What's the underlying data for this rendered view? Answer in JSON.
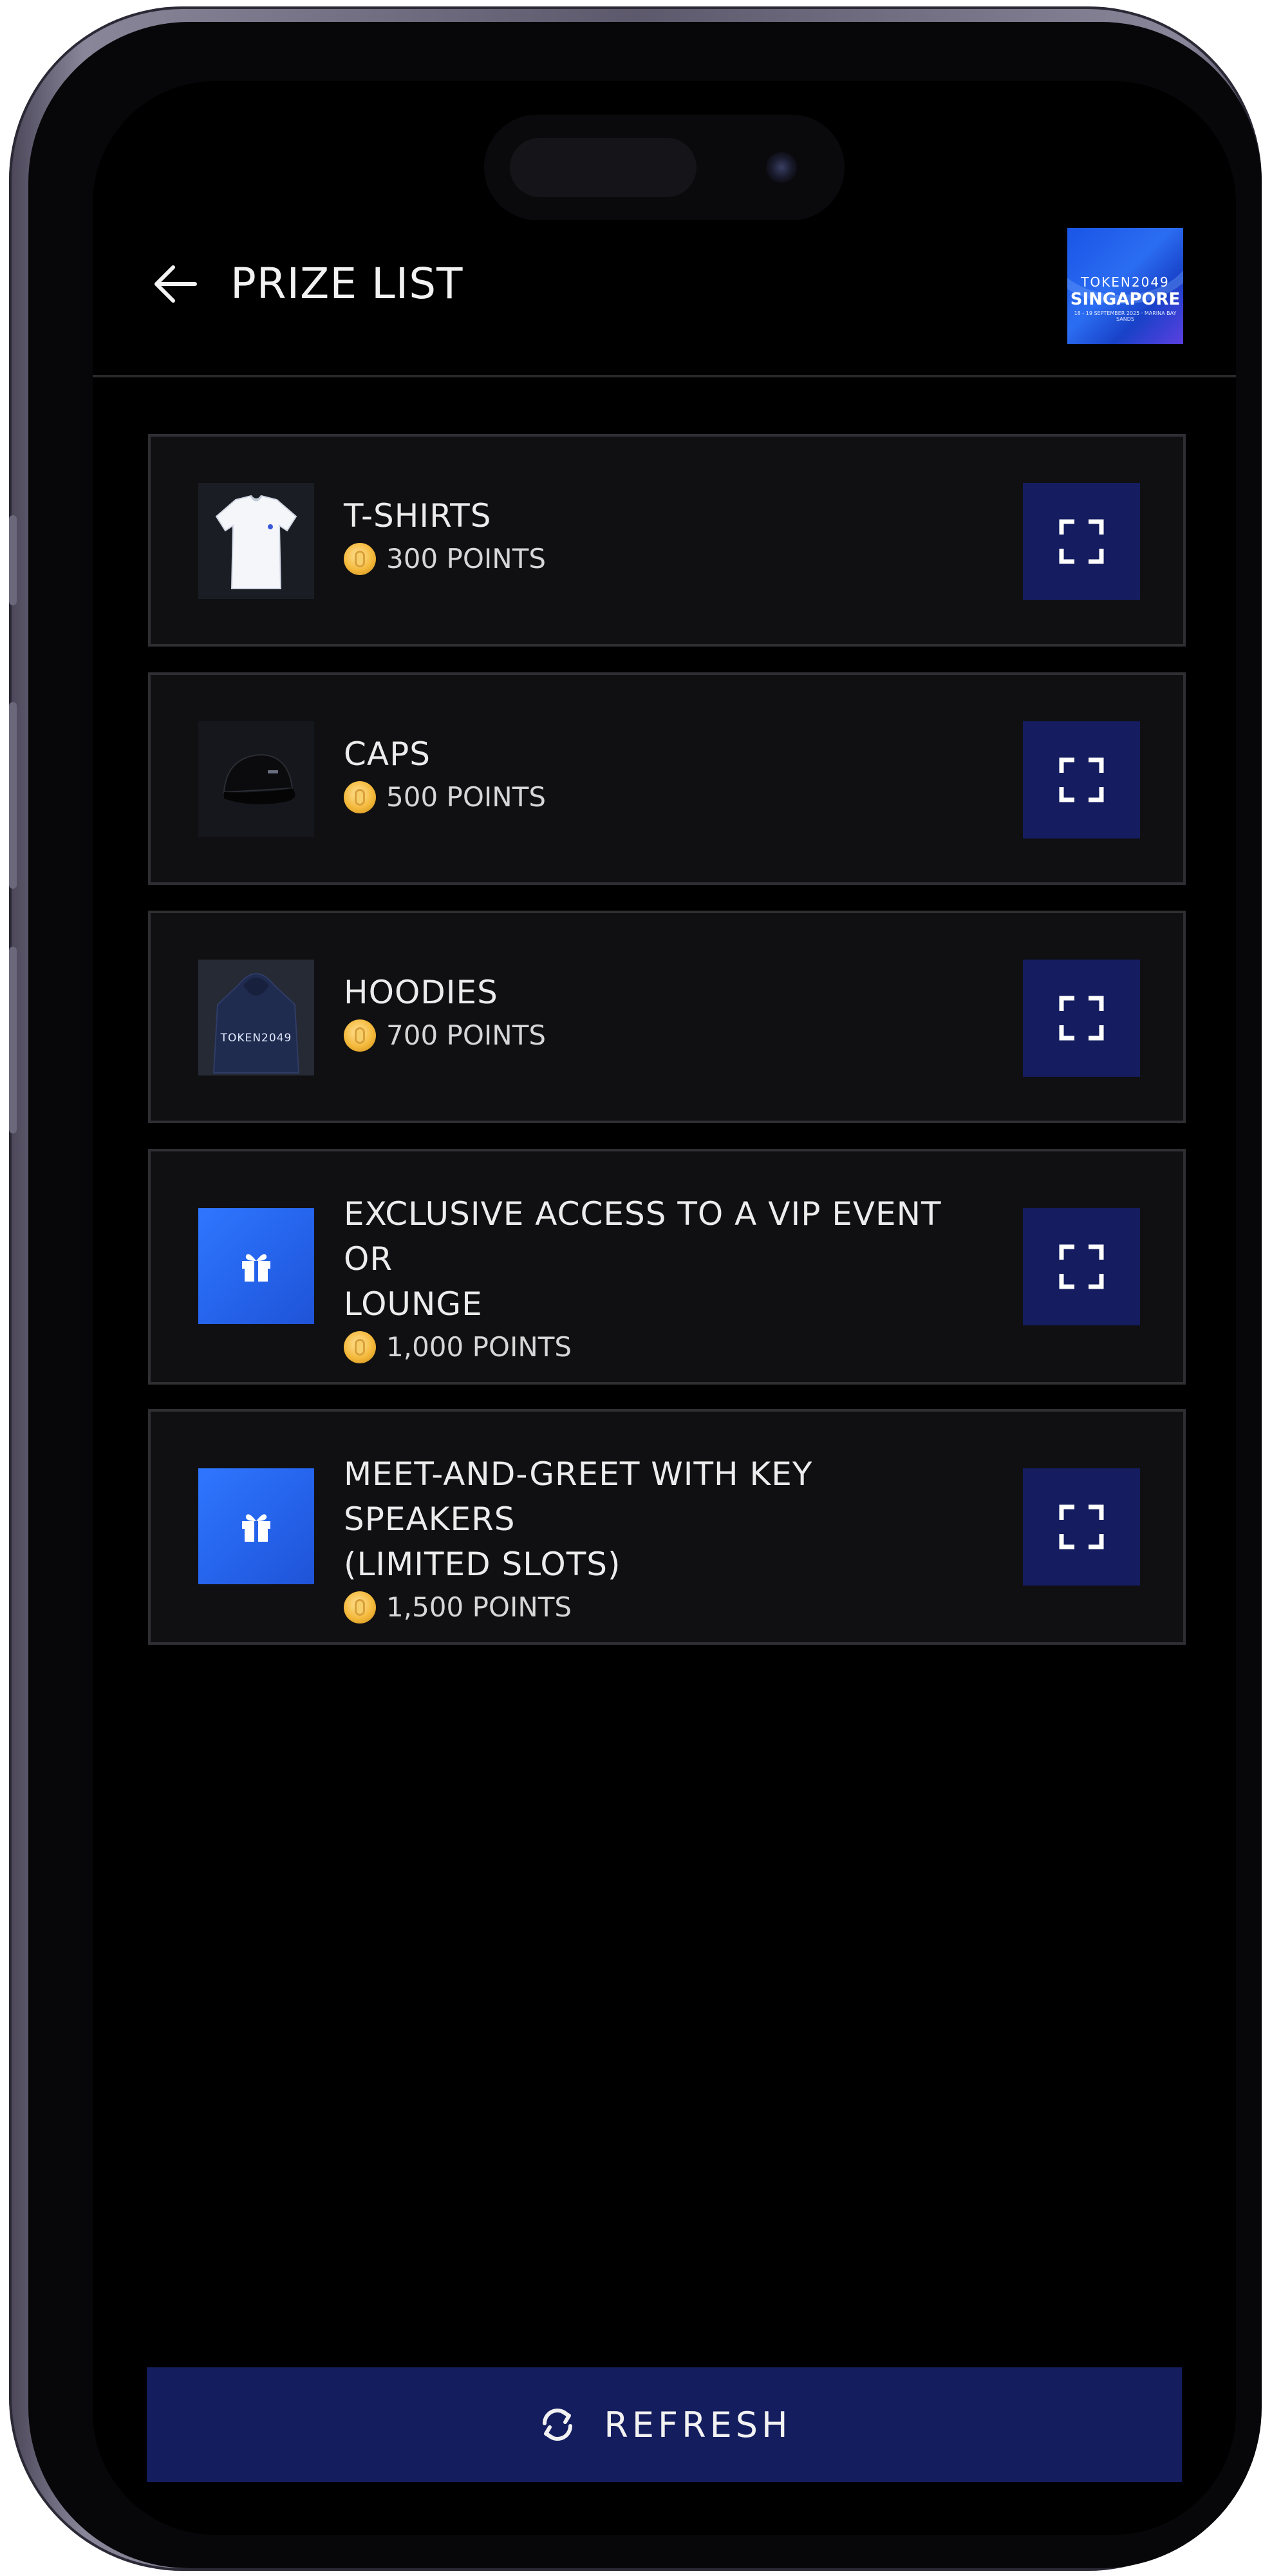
{
  "header": {
    "title": "PRIZE LIST",
    "back_icon": "arrow-left-icon",
    "logo": {
      "line1": "TOKEN2049",
      "line2": "SINGAPORE",
      "line3": "18 - 19 SEPTEMBER 2025 · MARINA BAY SANDS"
    }
  },
  "prizes": [
    {
      "name": "T-SHIRTS",
      "points": "300 POINTS",
      "thumb": "t-shirt-image",
      "action_icon": "scan-icon"
    },
    {
      "name": "CAPS",
      "points": "500 POINTS",
      "thumb": "cap-image",
      "action_icon": "scan-icon"
    },
    {
      "name": "HOODIES",
      "points": "700 POINTS",
      "thumb": "hoodie-image",
      "thumb_text": "TOKEN2049",
      "action_icon": "scan-icon"
    },
    {
      "name_line1": "EXCLUSIVE ACCESS TO A VIP EVENT OR",
      "name_line2": "LOUNGE",
      "points": "1,000 POINTS",
      "thumb": "gift-icon",
      "action_icon": "scan-icon"
    },
    {
      "name_line1": "MEET-AND-GREET WITH KEY SPEAKERS",
      "name_line2": "(LIMITED SLOTS)",
      "points": "1,500 POINTS",
      "thumb": "gift-icon",
      "action_icon": "scan-icon"
    }
  ],
  "refresh": {
    "label": "REFRESH",
    "icon": "refresh-icon"
  },
  "colors": {
    "background": "#000000",
    "card": "#101012",
    "card_border": "#2e2e33",
    "accent_navy": "#151d60",
    "gift_blue": "#2563eb",
    "coin_gold": "#f4b93b"
  }
}
